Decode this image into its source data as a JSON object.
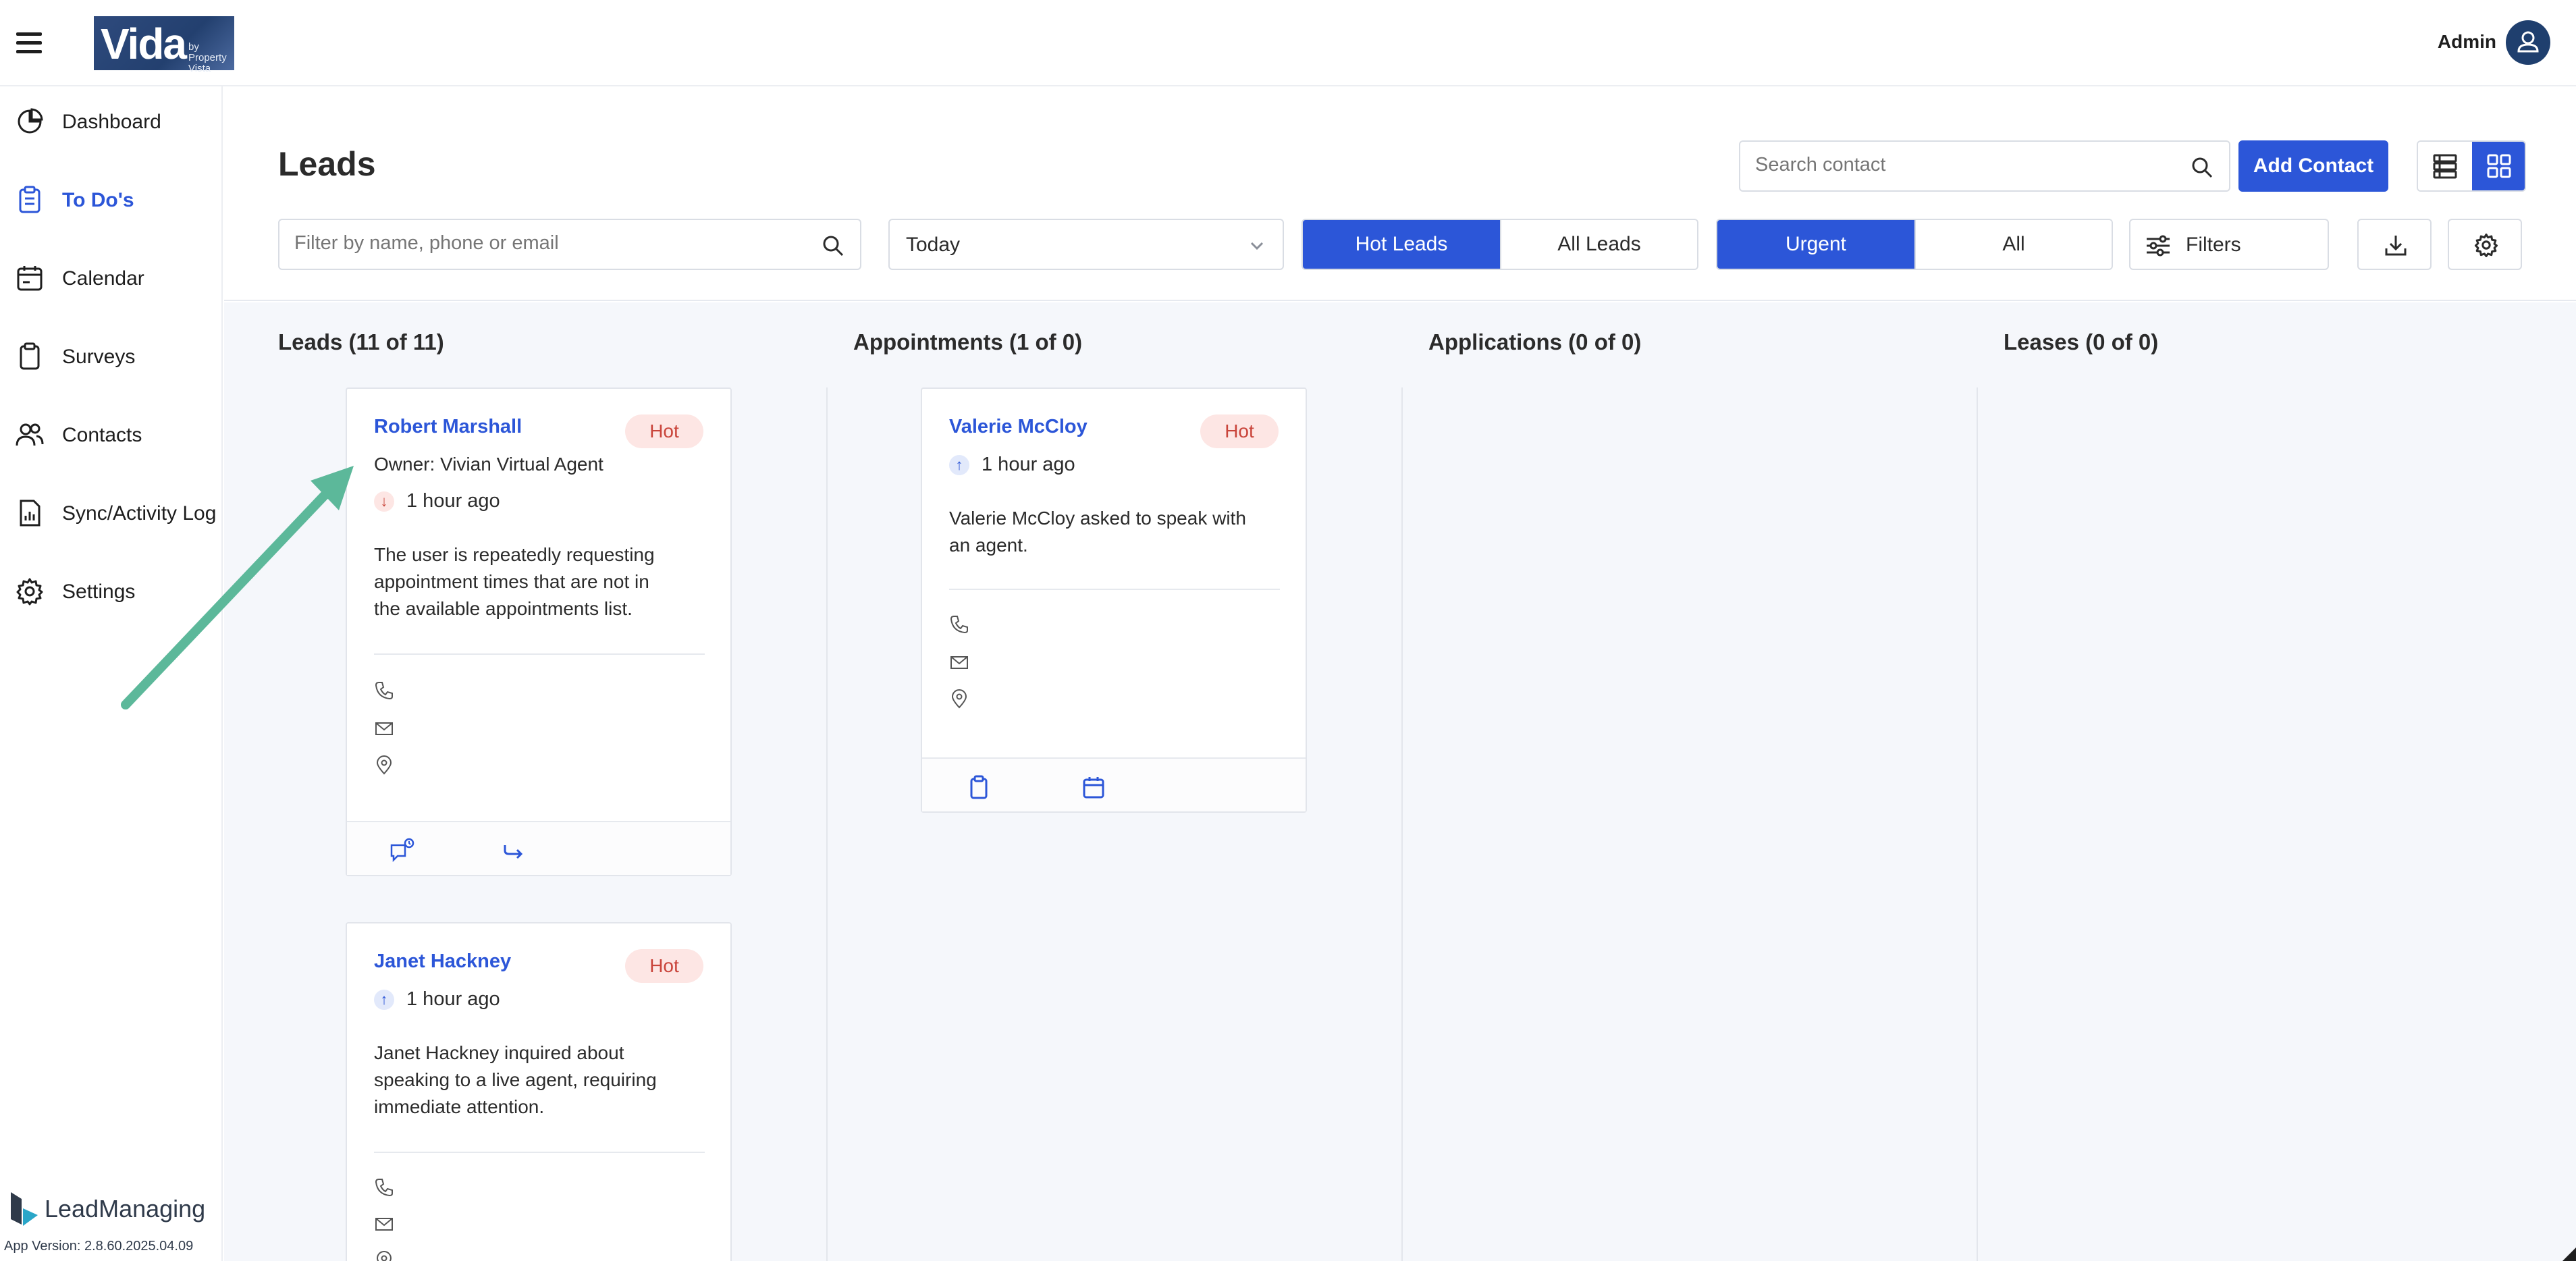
{
  "header": {
    "logo_main": "Vida",
    "logo_sub_line1": "by Property",
    "logo_sub_line2": "Vista",
    "user_label": "Admin"
  },
  "sidebar": {
    "items": [
      {
        "label": "Dashboard",
        "icon": "pie-chart-icon"
      },
      {
        "label": "To Do's",
        "icon": "clipboard-list-icon",
        "active": true
      },
      {
        "label": "Calendar",
        "icon": "calendar-icon"
      },
      {
        "label": "Surveys",
        "icon": "clipboard-icon"
      },
      {
        "label": "Contacts",
        "icon": "users-icon"
      },
      {
        "label": "Sync/Activity Log",
        "icon": "report-icon"
      },
      {
        "label": "Settings",
        "icon": "gear-icon"
      }
    ],
    "brand": "LeadManaging",
    "version": "App Version: 2.8.60.2025.04.09"
  },
  "toolbar": {
    "page_title": "Leads",
    "search_placeholder": "Search contact",
    "add_contact_label": "Add Contact",
    "filter_placeholder": "Filter by name, phone or email",
    "date_value": "Today",
    "lead_toggle": [
      "Hot Leads",
      "All Leads"
    ],
    "priority_toggle": [
      "Urgent",
      "All"
    ],
    "filters_label": "Filters"
  },
  "columns": [
    {
      "title": "Leads (11 of 11)"
    },
    {
      "title": "Appointments (1 of 0)"
    },
    {
      "title": "Applications (0 of 0)"
    },
    {
      "title": "Leases (0 of 0)"
    }
  ],
  "cards": {
    "robert": {
      "name": "Robert Marshall",
      "badge": "Hot",
      "owner": "Owner: Vivian Virtual Agent",
      "time": "1 hour ago",
      "trend": "down",
      "desc": [
        "The user is repeatedly requesting",
        "appointment times that are not in",
        "the available appointments list."
      ]
    },
    "janet": {
      "name": "Janet Hackney",
      "badge": "Hot",
      "time": "1 hour ago",
      "trend": "up",
      "desc": [
        "Janet Hackney inquired about",
        "speaking to a live agent, requiring",
        "immediate attention."
      ]
    },
    "valerie": {
      "name": "Valerie McCloy",
      "badge": "Hot",
      "time": "1 hour ago",
      "trend": "up",
      "desc": [
        "Valerie McCloy asked to speak with",
        "an agent."
      ]
    }
  },
  "colors": {
    "accent": "#2c56d8",
    "hot_badge_bg": "#fde6e4",
    "hot_badge_text": "#c9443a",
    "annotation_arrow": "#5cb89a"
  }
}
